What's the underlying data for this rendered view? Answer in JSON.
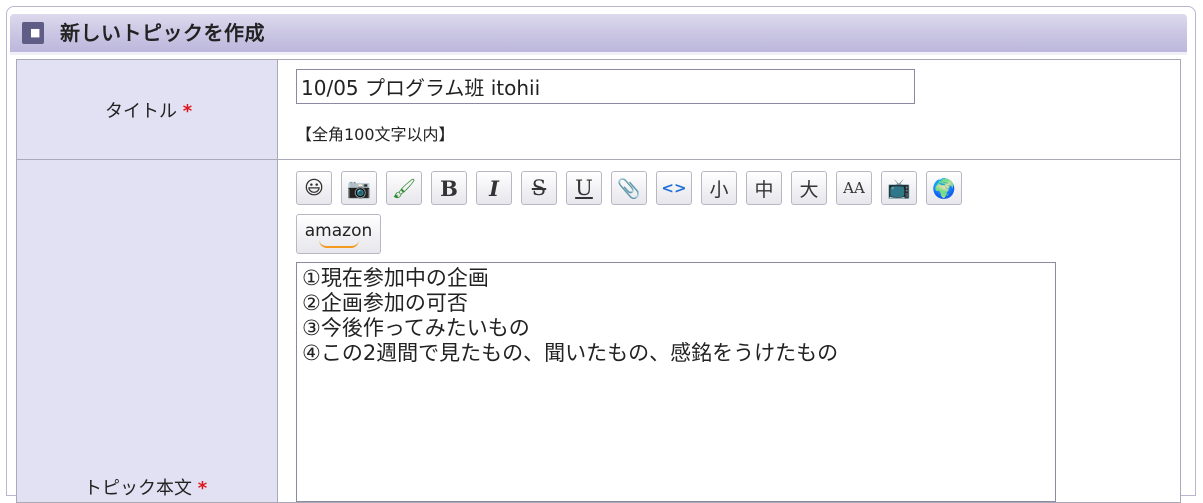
{
  "header": {
    "title": "新しいトピックを作成"
  },
  "form": {
    "title_label": "タイトル",
    "required_mark": "*",
    "title_value": "10/05 プログラム班 itohii",
    "title_note": "【全角100文字以内】",
    "body_label": "トピック本文",
    "body_value": "①現在参加中の企画\n②企画参加の可否\n③今後作ってみたいもの\n④この2週間で見たもの、聞いたもの、感銘をうけたもの"
  },
  "toolbar": {
    "buttons": [
      {
        "name": "emoji-icon",
        "glyph": "😃"
      },
      {
        "name": "camera-icon",
        "glyph": "📷"
      },
      {
        "name": "color-pen-icon",
        "glyph": "🖌"
      },
      {
        "name": "bold-button",
        "glyph": "B"
      },
      {
        "name": "italic-button",
        "glyph": "I"
      },
      {
        "name": "strike-button",
        "glyph": "S"
      },
      {
        "name": "underline-button",
        "glyph": "U"
      },
      {
        "name": "attach-icon",
        "glyph": "📎"
      },
      {
        "name": "link-icon",
        "glyph": "<>"
      },
      {
        "name": "size-small-button",
        "glyph": "小"
      },
      {
        "name": "size-medium-button",
        "glyph": "中"
      },
      {
        "name": "size-large-button",
        "glyph": "大"
      },
      {
        "name": "font-icon",
        "glyph": "AA"
      },
      {
        "name": "video-icon",
        "glyph": "📺"
      },
      {
        "name": "globe-icon",
        "glyph": "🌍"
      }
    ],
    "amazon_label": "amazon"
  }
}
